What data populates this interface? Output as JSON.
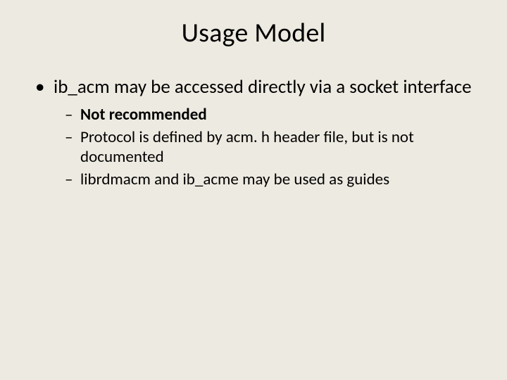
{
  "title": "Usage Model",
  "bullets": {
    "b1": "ib_acm may be accessed directly via a socket interface",
    "sub1": "Not recommended",
    "sub2": "Protocol is defined by acm. h header file, but is not documented",
    "sub3": "librdmacm and ib_acme may be used as guides"
  }
}
